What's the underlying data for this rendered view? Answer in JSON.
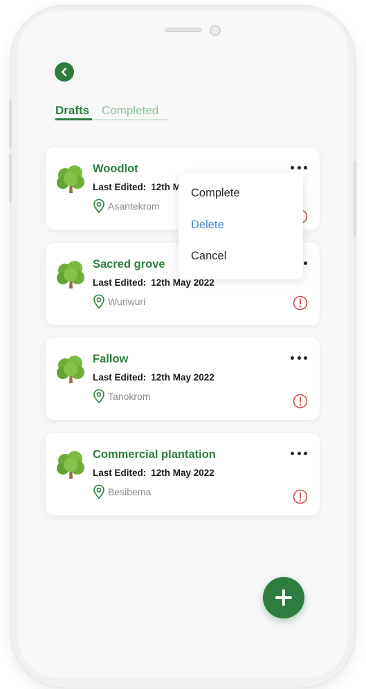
{
  "tabs": {
    "drafts": "Drafts",
    "completed": "Completed"
  },
  "colors": {
    "primary": "#2e7d40",
    "delete": "#4a86c5",
    "warning": "#d84a4a"
  },
  "cards": [
    {
      "title": "Woodlot",
      "edited_label": "Last Edited:",
      "edited_date": "12th May 2022",
      "location": "Asantekrom",
      "icon": "tree-icon",
      "status_icon": "alert-icon"
    },
    {
      "title": "Sacred grove",
      "edited_label": "Last Edited:",
      "edited_date": "12th May 2022",
      "location": "Wuriwuri",
      "icon": "tree-icon",
      "status_icon": "alert-icon"
    },
    {
      "title": "Fallow",
      "edited_label": "Last Edited:",
      "edited_date": "12th May 2022",
      "location": "Tanokrom",
      "icon": "tree-icon",
      "status_icon": "alert-icon"
    },
    {
      "title": "Commercial plantation",
      "edited_label": "Last Edited:",
      "edited_date": "12th May 2022",
      "location": "Besibema",
      "icon": "tree-icon",
      "status_icon": "alert-icon"
    }
  ],
  "menu": {
    "complete": "Complete",
    "delete": "Delete",
    "cancel": "Cancel"
  },
  "icons": {
    "back": "chevron-left-icon",
    "add": "plus-icon",
    "more": "more-horizontal-icon",
    "location": "map-pin-icon"
  }
}
